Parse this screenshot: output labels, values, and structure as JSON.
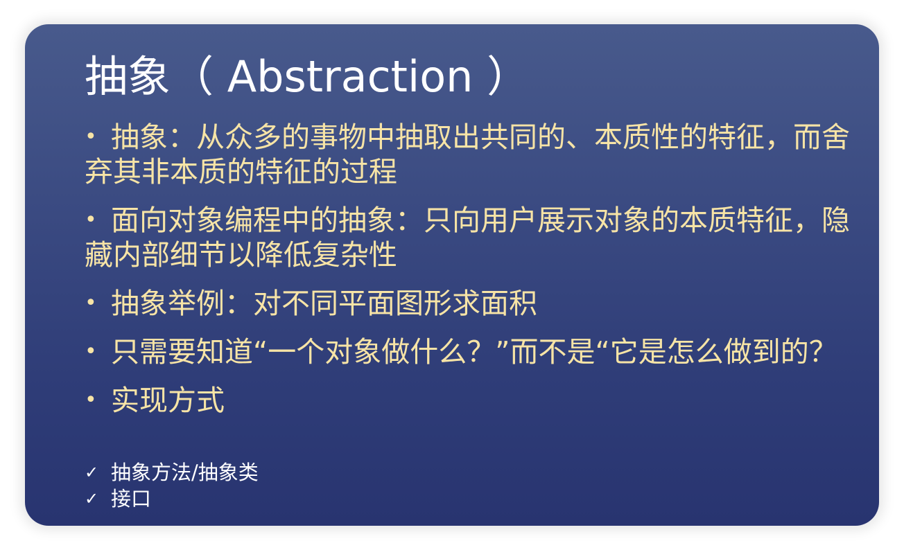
{
  "slide": {
    "title": "抽象（ Abstraction ）",
    "bullets": [
      {
        "text": "抽象：从众多的事物中抽取出共同的、本质性的特征，而舍弃其非本质的特征的过程"
      },
      {
        "text": "面向对象编程中的抽象：只向用户展示对象的本质特征，隐藏内部细节以降低复杂性"
      },
      {
        "text": "抽象举例：对不同平面图形求面积"
      },
      {
        "text": "只需要知道“一个对象做什么？”而不是“它是怎么做到的？"
      },
      {
        "text": "实现方式"
      }
    ],
    "subitems": [
      {
        "text": "抽象方法/抽象类"
      },
      {
        "text": "接口"
      }
    ],
    "bullet_symbol": "•",
    "check_symbol": "✓"
  },
  "colors": {
    "background_top": "#485a8c",
    "background_bottom": "#283470",
    "title": "#ffffff",
    "bullet_text": "#f7e4a6",
    "subitem_text": "#ffffff"
  },
  "icons": {
    "bullet": "bullet-dot-icon",
    "subitem": "check-icon"
  }
}
